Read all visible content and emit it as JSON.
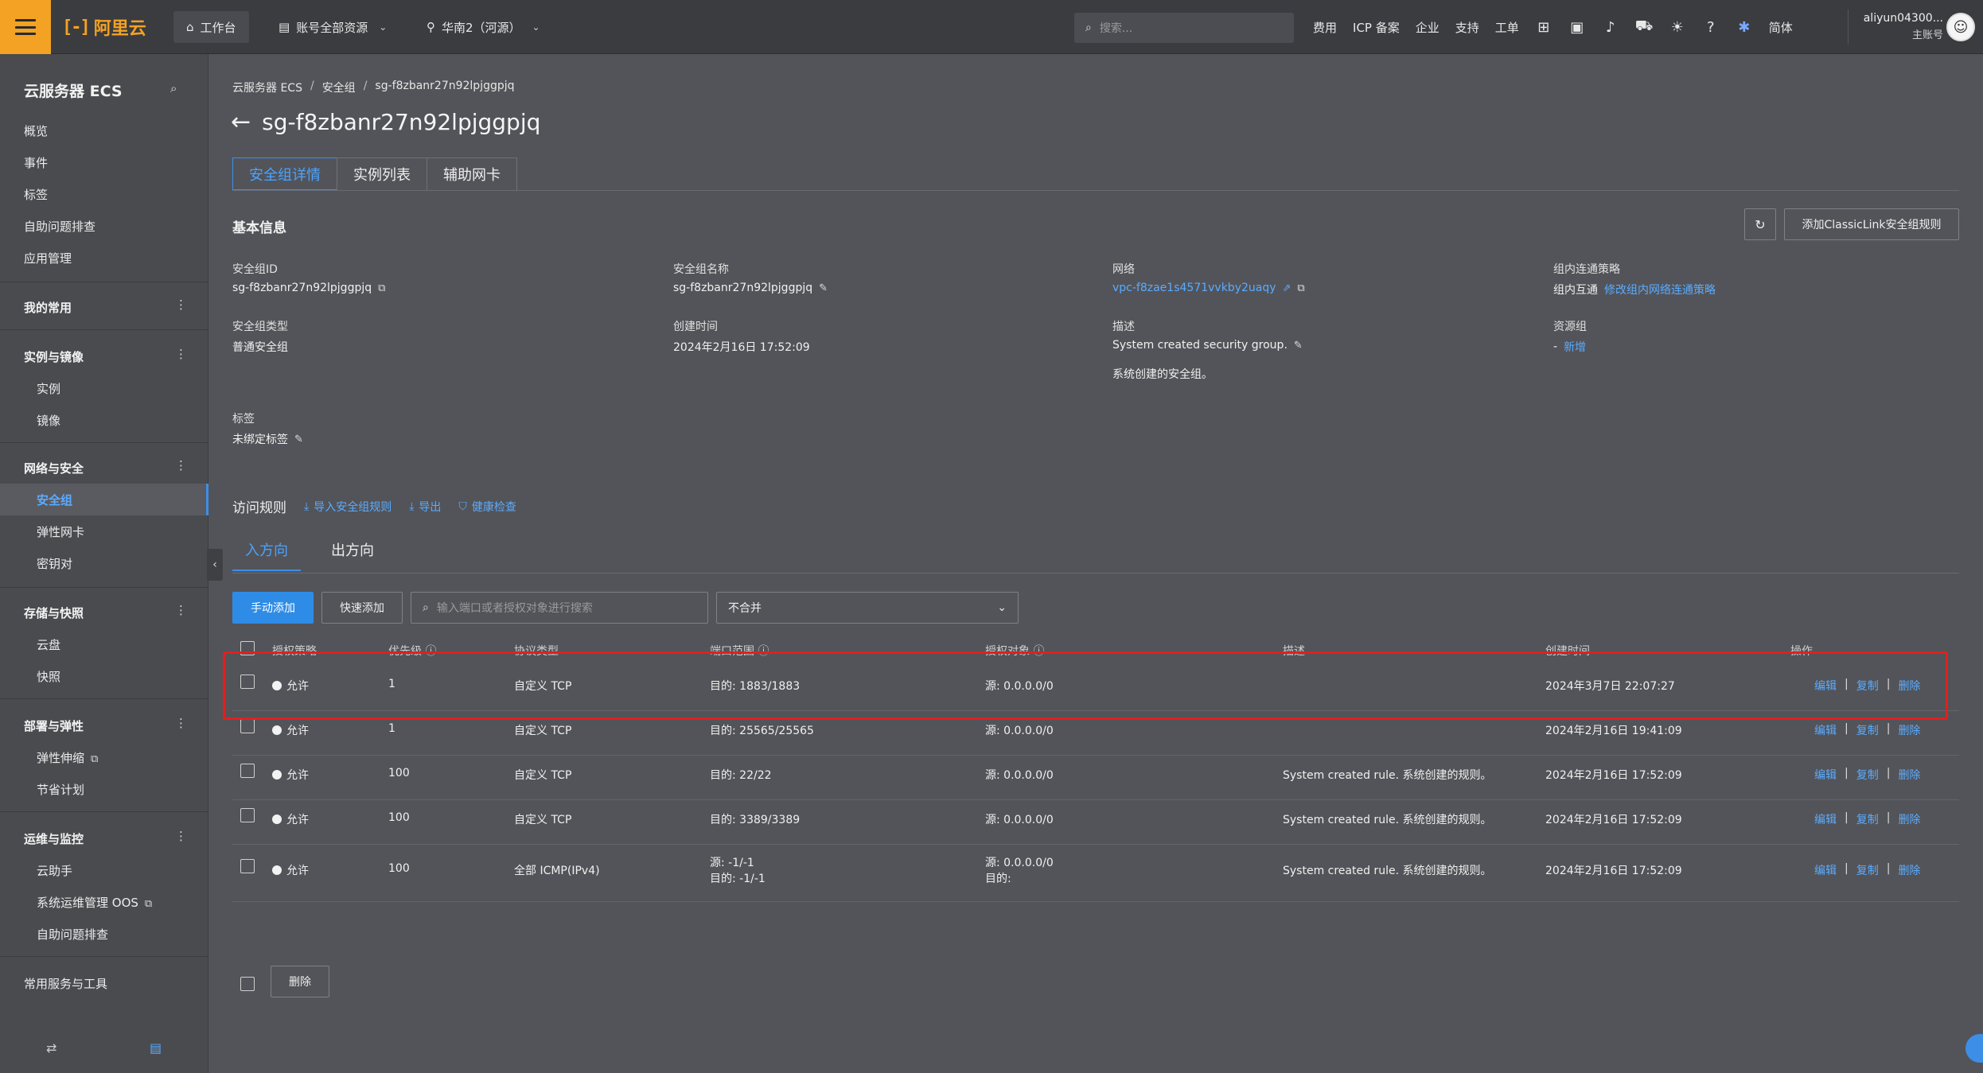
{
  "topbar": {
    "logo_text": "阿里云",
    "workbench": "工作台",
    "resources": "账号全部资源",
    "region": "华南2（河源）",
    "search_placeholder": "搜索...",
    "links": [
      "费用",
      "ICP 备案",
      "企业",
      "支持",
      "工单"
    ],
    "lang": "简体",
    "user_name": "aliyun04300...",
    "user_role": "主账号"
  },
  "sidebar": {
    "title": "云服务器 ECS",
    "top_items": [
      "概览",
      "事件",
      "标签",
      "自助问题排查",
      "应用管理"
    ],
    "favorites": "我的常用",
    "groups": [
      {
        "name": "实例与镜像",
        "items": [
          "实例",
          "镜像"
        ]
      },
      {
        "name": "网络与安全",
        "items": [
          "安全组",
          "弹性网卡",
          "密钥对"
        ]
      },
      {
        "name": "存储与快照",
        "items": [
          "云盘",
          "快照"
        ]
      },
      {
        "name": "部署与弹性",
        "items": [
          "弹性伸缩",
          "节省计划"
        ]
      },
      {
        "name": "运维与监控",
        "items": [
          "云助手",
          "系统运维管理 OOS",
          "自助问题排查"
        ]
      }
    ],
    "tools": "常用服务与工具"
  },
  "breadcrumb": [
    "云服务器 ECS",
    "安全组",
    "sg-f8zbanr27n92lpjggpjq"
  ],
  "page_title": "sg-f8zbanr27n92lpjggpjq",
  "tabs": [
    "安全组详情",
    "实例列表",
    "辅助网卡"
  ],
  "basic": {
    "section_title": "基本信息",
    "classic_btn": "添加ClassicLink安全组规则",
    "fields": {
      "sg_id_label": "安全组ID",
      "sg_id": "sg-f8zbanr27n92lpjggpjq",
      "sg_name_label": "安全组名称",
      "sg_name": "sg-f8zbanr27n92lpjggpjq",
      "network_label": "网络",
      "network": "vpc-f8zae1s4571vvkby2uaqy",
      "intra_label": "组内连通策略",
      "intra_value": "组内互通",
      "intra_link": "修改组内网络连通策略",
      "type_label": "安全组类型",
      "type": "普通安全组",
      "created_label": "创建时间",
      "created": "2024年2月16日 17:52:09",
      "desc_label": "描述",
      "desc": "System created security group.",
      "desc2": "系统创建的安全组。",
      "rg_label": "资源组",
      "rg_dash": "-",
      "rg_link": "新增",
      "tag_label": "标签",
      "tag_value": "未绑定标签"
    }
  },
  "rules": {
    "title": "访问规则",
    "actions": [
      "导入安全组规则",
      "导出",
      "健康检查"
    ],
    "directions": [
      "入方向",
      "出方向"
    ],
    "btn_manual": "手动添加",
    "btn_quick": "快速添加",
    "search_placeholder": "输入端口或者授权对象进行搜索",
    "merge": "不合并",
    "headers": [
      "授权策略",
      "优先级",
      "协议类型",
      "端口范围",
      "授权对象",
      "描述",
      "创建时间",
      "操作"
    ],
    "op_labels": [
      "编辑",
      "复制",
      "删除"
    ],
    "rows": [
      {
        "policy": "允许",
        "priority": "1",
        "protocol": "自定义 TCP",
        "port": "目的: 1883/1883",
        "port2": "",
        "target": "源: 0.0.0.0/0",
        "target2": "",
        "desc": "",
        "created": "2024年3月7日 22:07:27"
      },
      {
        "policy": "允许",
        "priority": "1",
        "protocol": "自定义 TCP",
        "port": "目的: 25565/25565",
        "port2": "",
        "target": "源: 0.0.0.0/0",
        "target2": "",
        "desc": "",
        "created": "2024年2月16日 19:41:09"
      },
      {
        "policy": "允许",
        "priority": "100",
        "protocol": "自定义 TCP",
        "port": "目的: 22/22",
        "port2": "",
        "target": "源: 0.0.0.0/0",
        "target2": "",
        "desc": "System created rule. 系统创建的规则。",
        "created": "2024年2月16日 17:52:09"
      },
      {
        "policy": "允许",
        "priority": "100",
        "protocol": "自定义 TCP",
        "port": "目的: 3389/3389",
        "port2": "",
        "target": "源: 0.0.0.0/0",
        "target2": "",
        "desc": "System created rule. 系统创建的规则。",
        "created": "2024年2月16日 17:52:09"
      },
      {
        "policy": "允许",
        "priority": "100",
        "protocol": "全部 ICMP(IPv4)",
        "port": "源: -1/-1",
        "port2": "目的: -1/-1",
        "target": "源: 0.0.0.0/0",
        "target2": "目的:",
        "desc": "System created rule. 系统创建的规则。",
        "created": "2024年2月16日 17:52:09"
      }
    ],
    "delete_btn": "删除"
  }
}
